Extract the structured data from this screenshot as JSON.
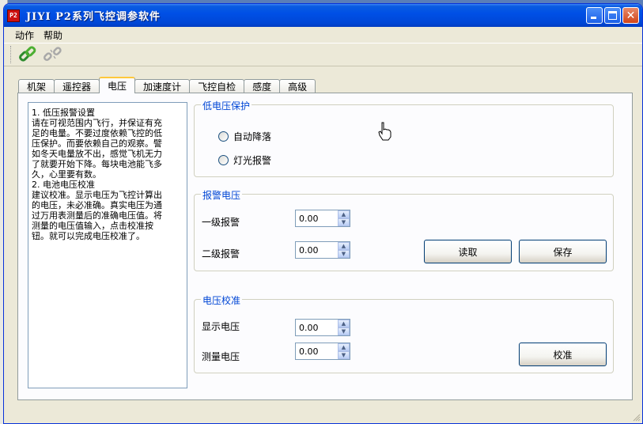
{
  "window": {
    "title": "JIYI P2系列飞控调参软件",
    "icon_text": "P2",
    "icon": "app-icon",
    "title_color": "#0050e6"
  },
  "menu": [
    {
      "label": "动作"
    },
    {
      "label": "帮助"
    }
  ],
  "toolbar": [
    {
      "icon": "connect-icon",
      "label": "connect"
    },
    {
      "icon": "disconnect-icon",
      "label": "disconnect"
    }
  ],
  "tabs": [
    {
      "label": "机架",
      "active": false
    },
    {
      "label": "遥控器",
      "active": false
    },
    {
      "label": "电压",
      "active": true
    },
    {
      "label": "加速度计",
      "active": false
    },
    {
      "label": "飞控自检",
      "active": false
    },
    {
      "label": "感度",
      "active": false
    },
    {
      "label": "高级",
      "active": false
    }
  ],
  "help": {
    "lines": [
      "1. 低压报警设置",
      "请在可视范围内飞行，并保证有充",
      "足的电量。不要过度依赖飞控的低",
      "压保护。而要依赖自己的观察。譬",
      "如冬天电量放不出，感觉飞机无力",
      "了就要开始下降。每块电池能飞多",
      "久，心里要有数。",
      "2. 电池电压校准",
      "建议校准。显示电压为飞控计算出",
      "的电压，未必准确。真实电压为通",
      "过万用表测量后的准确电压值。将",
      "测量的电压值输入，点击校准按",
      "钮。就可以完成电压校准了。"
    ]
  },
  "low_voltage": {
    "title": "低电压保护",
    "options": [
      {
        "label": "自动降落",
        "selected": false
      },
      {
        "label": "灯光报警",
        "selected": false
      }
    ]
  },
  "alarm": {
    "title": "报警电压",
    "level1_label": "一级报警",
    "level1_value": "0.00",
    "level2_label": "二级报警",
    "level2_value": "0.00",
    "read_label": "读取",
    "save_label": "保存"
  },
  "calibration": {
    "title": "电压校准",
    "display_label": "显示电压",
    "display_value": "0.00",
    "measure_label": "测量电压",
    "measure_value": "0.00",
    "calibrate_label": "校准"
  }
}
